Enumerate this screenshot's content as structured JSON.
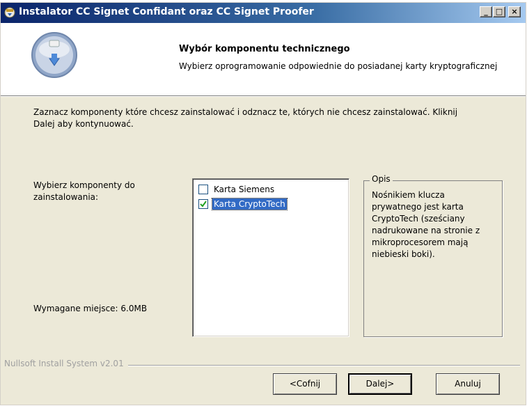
{
  "window": {
    "title": "Instalator CC Signet Confidant oraz CC Signet Proofer",
    "minimize_glyph": "_",
    "maximize_glyph": "□",
    "close_glyph": "×"
  },
  "header": {
    "title": "Wybór komponentu technicznego",
    "subtitle": "Wybierz oprogramowanie odpowiednie do posiadanej karty kryptograficznej"
  },
  "body": {
    "intro": "Zaznacz komponenty które chcesz zainstalować i odznacz te, których nie chcesz zainstalować. Kliknij Dalej aby kontynuować.",
    "choose_label": "Wybierz komponenty do zainstalowania:",
    "space_required": "Wymagane miejsce: 6.0MB"
  },
  "components": [
    {
      "label": "Karta Siemens",
      "checked": false,
      "selected": false
    },
    {
      "label": "Karta CryptoTech",
      "checked": true,
      "selected": true
    }
  ],
  "description": {
    "legend": "Opis",
    "text": "Nośnikiem klucza prywatnego jest karta CryptoTech (sześciany nadrukowane na stronie z mikroprocesorem mają niebieski boki)."
  },
  "footer": {
    "branding": "Nullsoft Install System v2.01",
    "back_label": "<Cofnij",
    "next_label": "Dalej>",
    "cancel_label": "Anuluj"
  },
  "colors": {
    "titlebar_start": "#0a246a",
    "titlebar_end": "#a6caf0",
    "selection": "#316ac5",
    "dialog_bg": "#ece9d8"
  },
  "icons": {
    "app": "installer-icon",
    "logo": "cd-download-icon",
    "checkmark": "checkmark-icon"
  }
}
